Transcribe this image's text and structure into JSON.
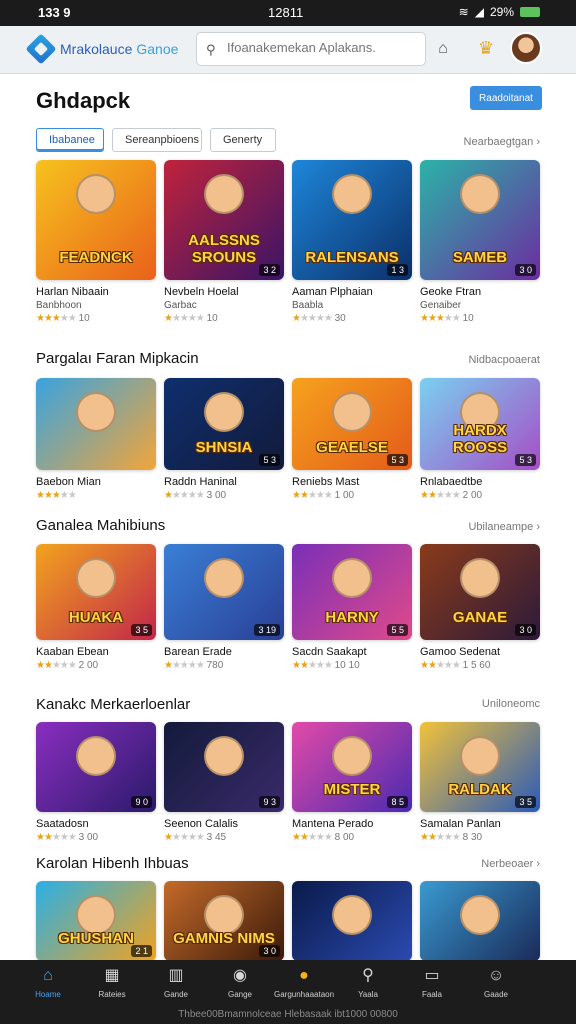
{
  "status_bar": {
    "time": "133 9",
    "center": "12811",
    "battery": "29%"
  },
  "header": {
    "app_name": "Mrakolauce",
    "app_sub": "Ganoe",
    "search_placeholder": "Ifoanakemekan Aplakans."
  },
  "page": {
    "title": "Ghdapck",
    "primary_button": "Raadoitanat",
    "tabs": [
      "Ibabanee",
      "Sereanpbioens",
      "Generty"
    ],
    "top_link": "Nearbaegtgan"
  },
  "sections": [
    {
      "title": "",
      "link": "",
      "cards": [
        {
          "art": "FEADNCK",
          "title": "Harlan Nibaain",
          "meta": "Banbhoon",
          "stars": 3,
          "rating": "10",
          "badge": "",
          "bg": "linear-gradient(135deg,#f7c21f,#e9611a)"
        },
        {
          "art": "AALSSNS SROUNS",
          "title": "Nevbeln Hoelal",
          "meta": "Garbac",
          "stars": 1,
          "rating": "10",
          "badge": "3 2",
          "bg": "linear-gradient(135deg,#c0233c,#3a1466)"
        },
        {
          "art": "RALENSANS",
          "title": "Aaman Plphaian",
          "meta": "Baabla",
          "stars": 1,
          "rating": "30",
          "badge": "1 3",
          "bg": "linear-gradient(135deg,#1e86d9,#0b2f6a)"
        },
        {
          "art": "SAMEB",
          "title": "Geoke Ftran",
          "meta": "Genaiber",
          "stars": 3,
          "rating": "10",
          "badge": "3 0",
          "bg": "linear-gradient(135deg,#2bb3a8,#6c2ca0)"
        }
      ]
    },
    {
      "title": "Pargalaı Faran Mipkacin",
      "link": "Nidbacpoaerat",
      "cards": [
        {
          "art": "",
          "title": "Baebon Mian",
          "meta": "",
          "stars": 3,
          "rating": "",
          "badge": "",
          "bg": "linear-gradient(135deg,#39a3e0,#f2a53a)"
        },
        {
          "art": "SHNSIA",
          "title": "Raddn Haninal",
          "meta": "",
          "stars": 1,
          "rating": "3 00",
          "badge": "5 3",
          "bg": "linear-gradient(135deg,#0f2f6e,#121a3a)"
        },
        {
          "art": "GEAELSE",
          "title": "Reniebs Mast",
          "meta": "",
          "stars": 2,
          "rating": "1 00",
          "badge": "5 3",
          "bg": "linear-gradient(135deg,#f6a21e,#e45b1a)"
        },
        {
          "art": "HARDX ROOSS",
          "title": "Rnlabaedtbe",
          "meta": "",
          "stars": 2,
          "rating": "2 00",
          "badge": "5 3",
          "bg": "linear-gradient(135deg,#7ad0f0,#a54ec6)"
        }
      ]
    },
    {
      "title": "Ganalea Mahibiuns",
      "link": "Ubilaneampe",
      "cards": [
        {
          "art": "HUAKA",
          "title": "Kaaban Ebean",
          "meta": "",
          "stars": 2,
          "rating": "2 00",
          "badge": "3 5",
          "bg": "linear-gradient(135deg,#f2a31e,#c2264a)"
        },
        {
          "art": "",
          "title": "Barean Erade",
          "meta": "",
          "stars": 1,
          "rating": "780",
          "badge": "3 19",
          "bg": "linear-gradient(135deg,#3a7fd6,#2a3f96)"
        },
        {
          "art": "HARNY",
          "title": "Sacdn Saakapt",
          "meta": "",
          "stars": 2,
          "rating": "10 10",
          "badge": "5 5",
          "bg": "linear-gradient(135deg,#7a2fb8,#e04a8a)"
        },
        {
          "art": "GANAE",
          "title": "Gamoo Sedenat",
          "meta": "",
          "stars": 2,
          "rating": "1 5 60",
          "badge": "3 0",
          "bg": "linear-gradient(135deg,#8a3b1a,#2c1a3a)"
        }
      ]
    },
    {
      "title": "Kanakc Merkaerloenlar",
      "link": "Uniloneomc",
      "cards": [
        {
          "art": "",
          "title": "Saatadosn",
          "meta": "",
          "stars": 2,
          "rating": "3 00",
          "badge": "9 0",
          "bg": "linear-gradient(135deg,#8a2ec0,#2a1a6a)"
        },
        {
          "art": "",
          "title": "Seenon Calalis",
          "meta": "",
          "stars": 1,
          "rating": "3 45",
          "badge": "9 3",
          "bg": "linear-gradient(135deg,#121a3a,#3a2a6a)"
        },
        {
          "art": "MISTER",
          "title": "Mantena Perado",
          "meta": "",
          "stars": 2,
          "rating": "8 00",
          "badge": "8 5",
          "bg": "linear-gradient(135deg,#e24aa8,#4a2ab0)"
        },
        {
          "art": "RALDAK",
          "title": "Samalan Panlan",
          "meta": "",
          "stars": 2,
          "rating": "8 30",
          "badge": "3 5",
          "bg": "linear-gradient(135deg,#f2c23a,#2a5ab8)"
        }
      ]
    },
    {
      "title": "Karolan Hibenh Ihbuas",
      "link": "Nerbeoaer",
      "cards": [
        {
          "art": "GHUSHAN",
          "title": "",
          "meta": "",
          "stars": 0,
          "rating": "",
          "badge": "2 1",
          "bg": "linear-gradient(135deg,#2ab0e6,#f2a21e)"
        },
        {
          "art": "GAMNIS NIMS",
          "title": "",
          "meta": "",
          "stars": 0,
          "rating": "",
          "badge": "3 0",
          "bg": "linear-gradient(135deg,#c46a2a,#3a1a0a)"
        },
        {
          "art": "",
          "title": "",
          "meta": "",
          "stars": 0,
          "rating": "",
          "badge": "",
          "bg": "linear-gradient(135deg,#0a1a4a,#2a4ab0)"
        },
        {
          "art": "",
          "title": "",
          "meta": "",
          "stars": 0,
          "rating": "",
          "badge": "",
          "bg": "linear-gradient(135deg,#3a9ad0,#1a2a5a)"
        }
      ]
    }
  ],
  "bottom_nav": [
    {
      "label": "Hoame",
      "icon": "home-icon",
      "glyph": "⌂"
    },
    {
      "label": "Rateies",
      "icon": "grid-icon",
      "glyph": "▦"
    },
    {
      "label": "Gande",
      "icon": "store-icon",
      "glyph": "▥"
    },
    {
      "label": "Gange",
      "icon": "gamepad-icon",
      "glyph": "◉"
    },
    {
      "label": "Gargunhaaataon",
      "icon": "coin-icon",
      "glyph": "●"
    },
    {
      "label": "Yaala",
      "icon": "search-icon",
      "glyph": "⚲"
    },
    {
      "label": "Faala",
      "icon": "library-icon",
      "glyph": "▭"
    },
    {
      "label": "Gaade",
      "icon": "profile-icon",
      "glyph": "☺"
    }
  ],
  "footer": "Thbee00Bmamnolceae Hlebasaak ibt1000 00800"
}
